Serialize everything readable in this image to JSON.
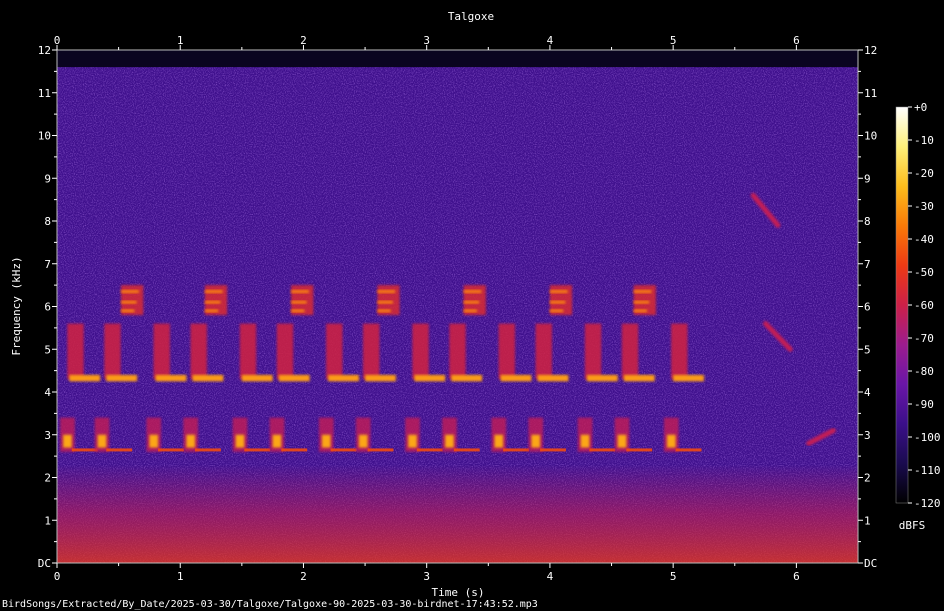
{
  "chart_data": {
    "type": "heatmap",
    "title": "Talgoxe",
    "xlabel": "Time (s)",
    "ylabel": "Frequency (kHz)",
    "xlim": [
      0,
      6.5
    ],
    "ylim": [
      0,
      12
    ],
    "x_ticks": [
      "0",
      "1",
      "2",
      "3",
      "4",
      "5",
      "6"
    ],
    "y_ticks": [
      "DC",
      "1",
      "2",
      "3",
      "4",
      "5",
      "6",
      "7",
      "8",
      "9",
      "10",
      "11",
      "12"
    ],
    "colorbar": {
      "label": "dBFS",
      "range": [
        -120,
        0
      ],
      "ticks": [
        "+0",
        "-10",
        "-20",
        "-30",
        "-40",
        "-50",
        "-60",
        "-70",
        "-80",
        "-90",
        "-100",
        "-110",
        "-120"
      ],
      "colors": [
        "#000000",
        "#1a0b4f",
        "#3b0f8a",
        "#6a16a8",
        "#9c1c8e",
        "#cc2048",
        "#ee3a14",
        "#fa7a08",
        "#fdbd1c",
        "#fef07a",
        "#ffffff"
      ]
    },
    "background_level_dbfs": -95,
    "low_frequency_noise_top_khz": 2.3,
    "notes_low": {
      "freq_khz": [
        2.6,
        3.4
      ],
      "times_s": [
        0.05,
        0.33,
        0.75,
        1.05,
        1.45,
        1.75,
        2.15,
        2.45,
        2.85,
        3.15,
        3.55,
        3.85,
        4.25,
        4.55,
        4.95
      ]
    },
    "notes_mid": {
      "freq_khz": [
        4.3,
        5.6
      ],
      "times_s": [
        0.1,
        0.4,
        0.8,
        1.1,
        1.5,
        1.8,
        2.2,
        2.5,
        2.9,
        3.2,
        3.6,
        3.9,
        4.3,
        4.6,
        5.0
      ]
    },
    "notes_high": {
      "freq_khz": [
        5.8,
        6.5
      ],
      "times_s": [
        0.52,
        1.2,
        1.9,
        2.6,
        3.3,
        4.0,
        4.68
      ]
    },
    "faint_events": [
      {
        "t_start": 5.65,
        "t_end": 5.85,
        "f_start": 8.6,
        "f_end": 7.9
      },
      {
        "t_start": 5.75,
        "t_end": 5.95,
        "f_start": 5.6,
        "f_end": 5.0
      },
      {
        "t_start": 6.1,
        "t_end": 6.3,
        "f_start": 2.8,
        "f_end": 3.1
      }
    ],
    "caption": "BirdSongs/Extracted/By_Date/2025-03-30/Talgoxe/Talgoxe-90-2025-03-30-birdnet-17:43:52.mp3"
  }
}
